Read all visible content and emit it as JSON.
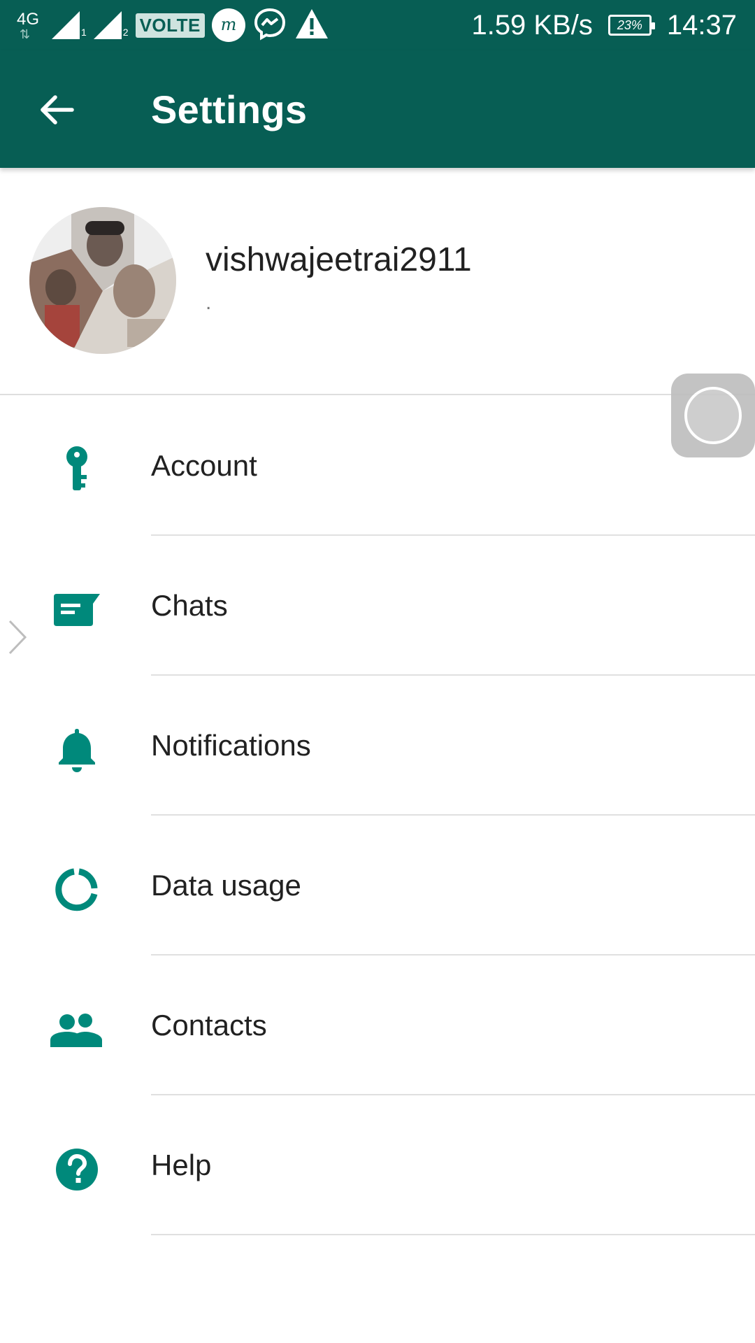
{
  "status_bar": {
    "network_type": "4G",
    "sim1": "1",
    "sim2": "2",
    "volte": "VOLTE",
    "speed": "1.59 KB/s",
    "battery": "23%",
    "time": "14:37"
  },
  "app_bar": {
    "title": "Settings"
  },
  "profile": {
    "name": "vishwajeetrai2911",
    "status": "."
  },
  "menu": {
    "items": [
      {
        "label": "Account",
        "icon": "key-icon"
      },
      {
        "label": "Chats",
        "icon": "chat-icon"
      },
      {
        "label": "Notifications",
        "icon": "bell-icon"
      },
      {
        "label": "Data usage",
        "icon": "data-usage-icon"
      },
      {
        "label": "Contacts",
        "icon": "contacts-icon"
      },
      {
        "label": "Help",
        "icon": "help-icon"
      }
    ]
  },
  "colors": {
    "primary": "#075e54",
    "accent": "#00897b",
    "text": "#212121",
    "divider": "#e0e0e0"
  }
}
